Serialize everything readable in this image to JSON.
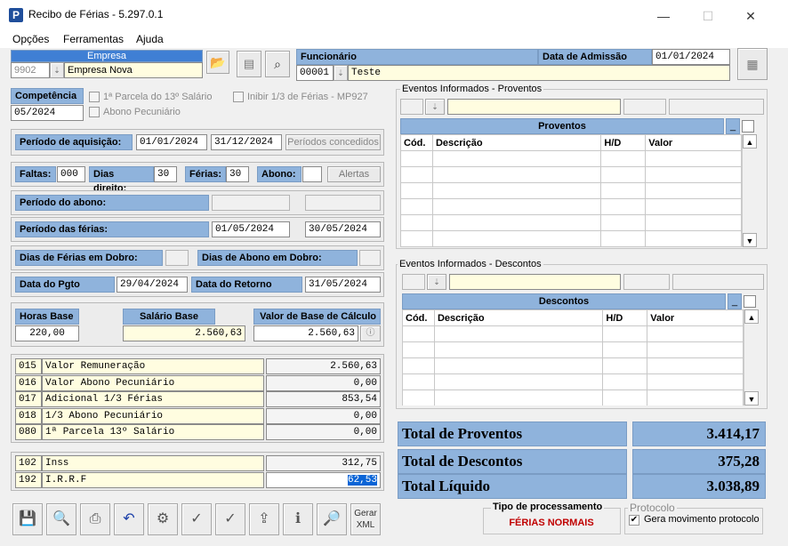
{
  "window": {
    "title": "Recibo de Férias - 5.297.0.1",
    "minimize": "—",
    "maximize": "☐",
    "close": "✕"
  },
  "menu": [
    "Opções",
    "Ferramentas",
    "Ajuda"
  ],
  "empresa": {
    "label": "Empresa",
    "code": "9902",
    "name": "Empresa Nova"
  },
  "funcionario": {
    "label": "Funcionário",
    "code": "00001",
    "name": "Teste"
  },
  "admissao": {
    "label": "Data de Admissão",
    "value": "01/01/2024"
  },
  "competencia": {
    "label": "Competência",
    "value": "05/2024",
    "parcela13": "1ª Parcela do 13º Salário",
    "abono": "Abono Pecuniário",
    "inibir": "Inibir 1/3 de Férias - MP927"
  },
  "aquisicao": {
    "label": "Período de aquisição:",
    "start": "01/01/2024",
    "end": "31/12/2024",
    "button": "Períodos concedidos"
  },
  "faltas": {
    "faltas_label": "Faltas:",
    "faltas": "000",
    "direito_label": "Dias direito:",
    "direito": "30",
    "ferias_label": "Férias:",
    "ferias": "30",
    "abono_label": "Abono:",
    "abono": "",
    "alertas": "Alertas"
  },
  "periodo_abono": {
    "label": "Período do abono:"
  },
  "periodo_ferias": {
    "label": "Período das férias:",
    "start": "01/05/2024",
    "end": "30/05/2024"
  },
  "dobro": {
    "ferias_label": "Dias de Férias em Dobro:",
    "abono_label": "Dias de Abono em Dobro:"
  },
  "pagamento": {
    "pgto_label": "Data do Pgto",
    "pgto": "29/04/2024",
    "retorno_label": "Data do Retorno",
    "retorno": "31/05/2024"
  },
  "bases": {
    "horas_label": "Horas Base",
    "horas": "220,00",
    "salario_label": "Salário Base",
    "salario": "2.560,63",
    "calculo_label": "Valor de Base de Cálculo",
    "calculo": "2.560,63"
  },
  "proventos_items": [
    {
      "code": "015",
      "desc": "Valor Remuneração",
      "value": "2.560,63"
    },
    {
      "code": "016",
      "desc": "Valor Abono Pecuniário",
      "value": "0,00"
    },
    {
      "code": "017",
      "desc": "Adicional 1/3 Férias",
      "value": "853,54"
    },
    {
      "code": "018",
      "desc": "1/3 Abono Pecuniário",
      "value": "0,00"
    },
    {
      "code": "080",
      "desc": "1ª Parcela 13º Salário",
      "value": "0,00"
    }
  ],
  "descontos_items": [
    {
      "code": "102",
      "desc": "Inss",
      "value": "312,75"
    },
    {
      "code": "192",
      "desc": "I.R.R.F",
      "value": "62,53"
    }
  ],
  "eventos_proventos": {
    "group_label": "Eventos Informados - Proventos",
    "grid_title": "Proventos",
    "columns": [
      "Cód.",
      "Descrição",
      "H/D",
      "Valor"
    ]
  },
  "eventos_descontos": {
    "group_label": "Eventos Informados - Descontos",
    "grid_title": "Descontos",
    "columns": [
      "Cód.",
      "Descrição",
      "H/D",
      "Valor"
    ]
  },
  "totais": {
    "proventos_label": "Total de Proventos",
    "proventos": "3.414,17",
    "descontos_label": "Total de Descontos",
    "descontos": "375,28",
    "liquido_label": "Total Líquido",
    "liquido": "3.038,89"
  },
  "processamento": {
    "label": "Tipo de processamento",
    "value": "FÉRIAS NORMAIS"
  },
  "protocolo": {
    "label": "Protocolo",
    "checkbox": "Gera movimento protocolo",
    "checked": "✔"
  },
  "toolbar": {
    "xml_line1": "Gerar",
    "xml_line2": "XML"
  },
  "colors": {
    "label_blue": "#8fb3dc",
    "field_yellow": "#fffde0",
    "red_text": "#c00000"
  }
}
